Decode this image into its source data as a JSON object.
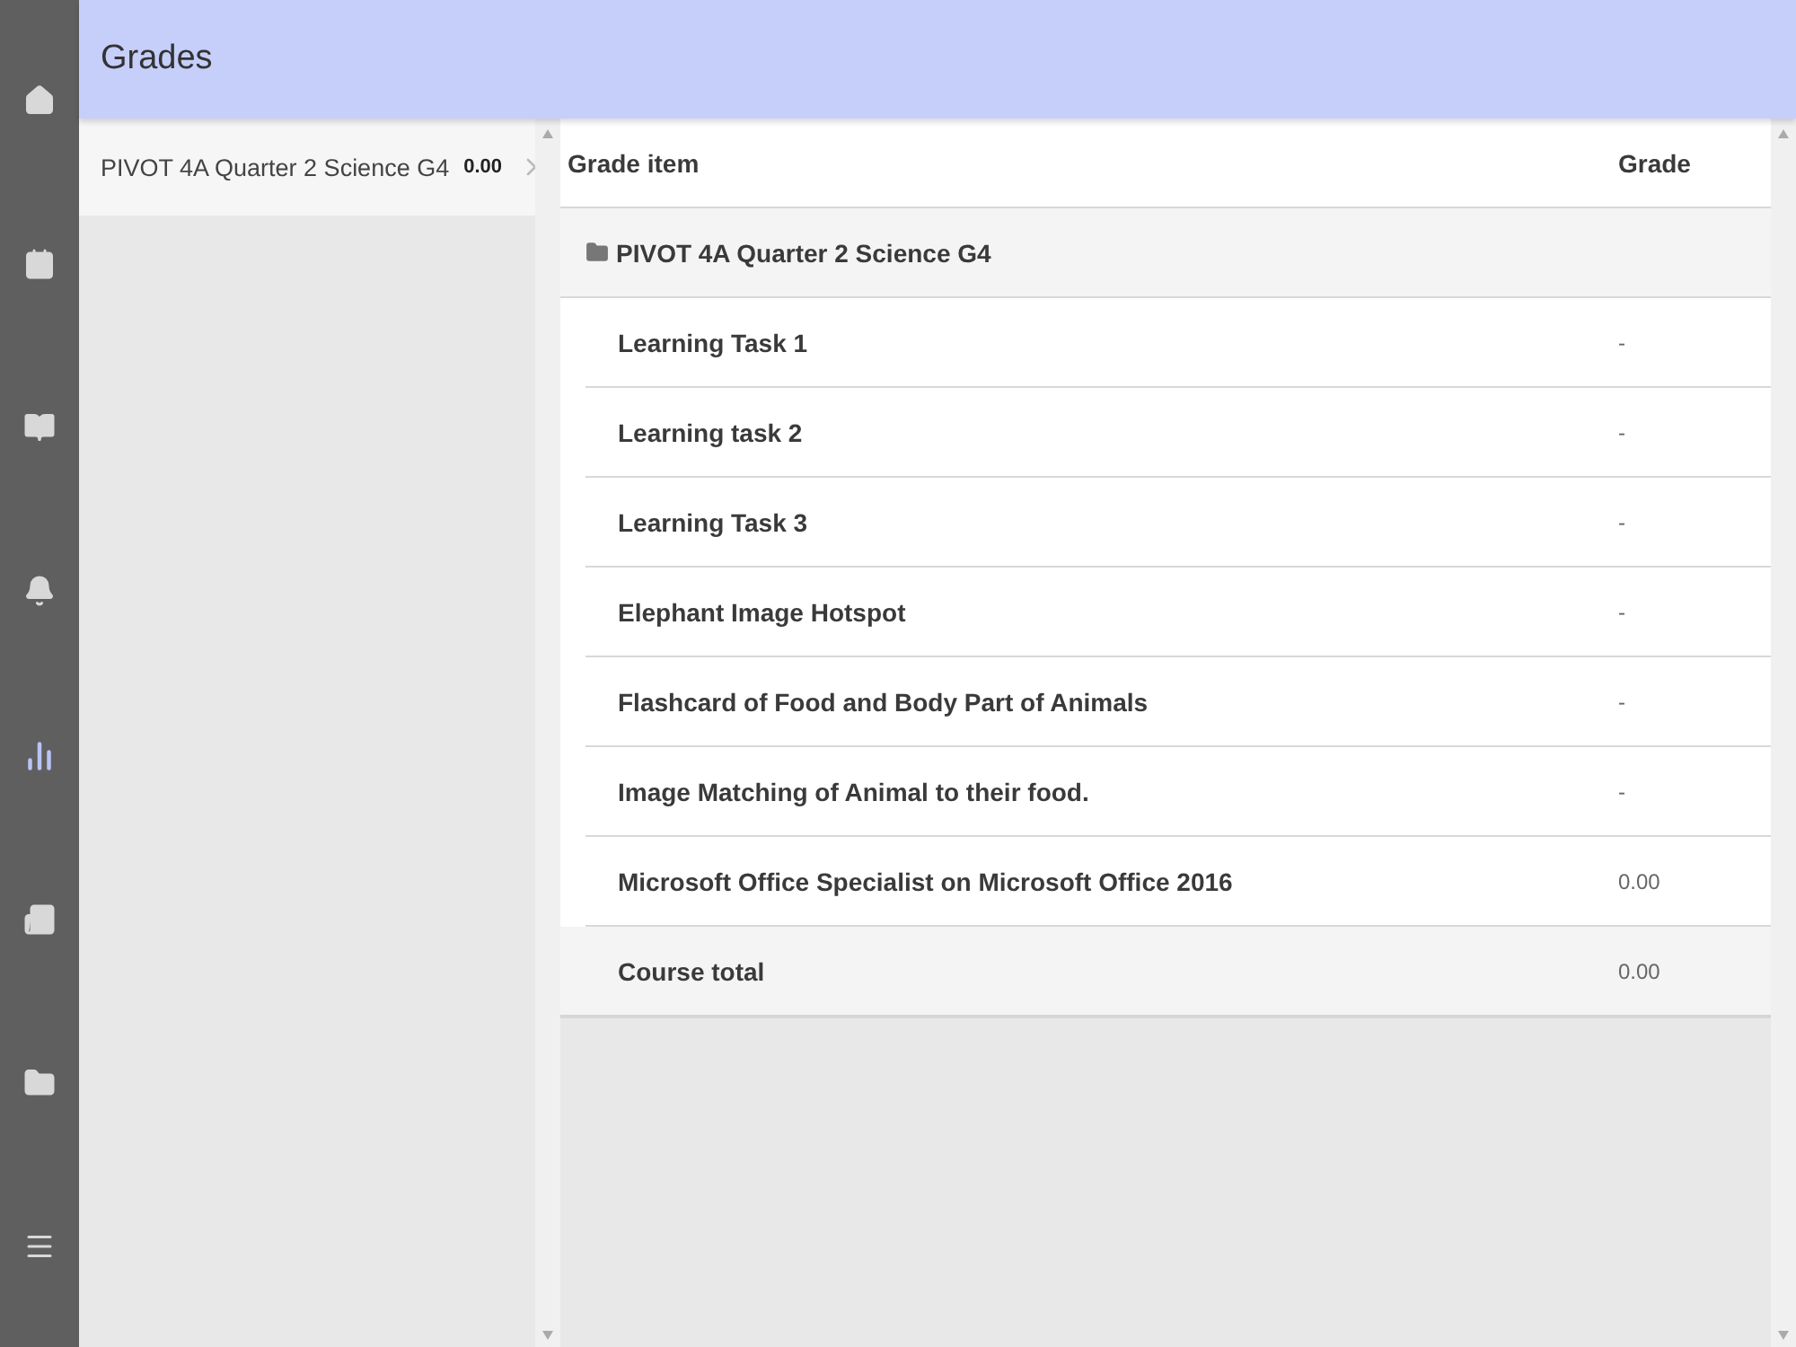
{
  "nav": [
    {
      "selected": false
    },
    {
      "selected": false
    },
    {
      "selected": false
    },
    {
      "selected": false
    },
    {
      "selected": true
    },
    {
      "selected": false
    },
    {
      "selected": false
    },
    {
      "selected": false
    }
  ],
  "header": {
    "title": "Grades"
  },
  "courses": [
    {
      "name": "PIVOT 4A Quarter 2 Science G4",
      "grade": "0.00",
      "selected": true
    }
  ],
  "table": {
    "columns": [
      "Grade item",
      "Grade"
    ],
    "category": {
      "name": "PIVOT 4A Quarter 2 Science G4"
    },
    "rows": [
      {
        "item": "Learning Task 1",
        "grade": "-"
      },
      {
        "item": "Learning task 2",
        "grade": "-"
      },
      {
        "item": "Learning Task 3",
        "grade": "-"
      },
      {
        "item": "Elephant Image Hotspot",
        "grade": "-"
      },
      {
        "item": "Flashcard of Food and Body Part of Animals",
        "grade": "-"
      },
      {
        "item": "Image Matching of Animal to their food.",
        "grade": "-"
      },
      {
        "item": "Microsoft Office Specialist on Microsoft Office 2016",
        "grade": "0.00"
      }
    ],
    "total": {
      "item": "Course total",
      "grade": "0.00"
    }
  }
}
